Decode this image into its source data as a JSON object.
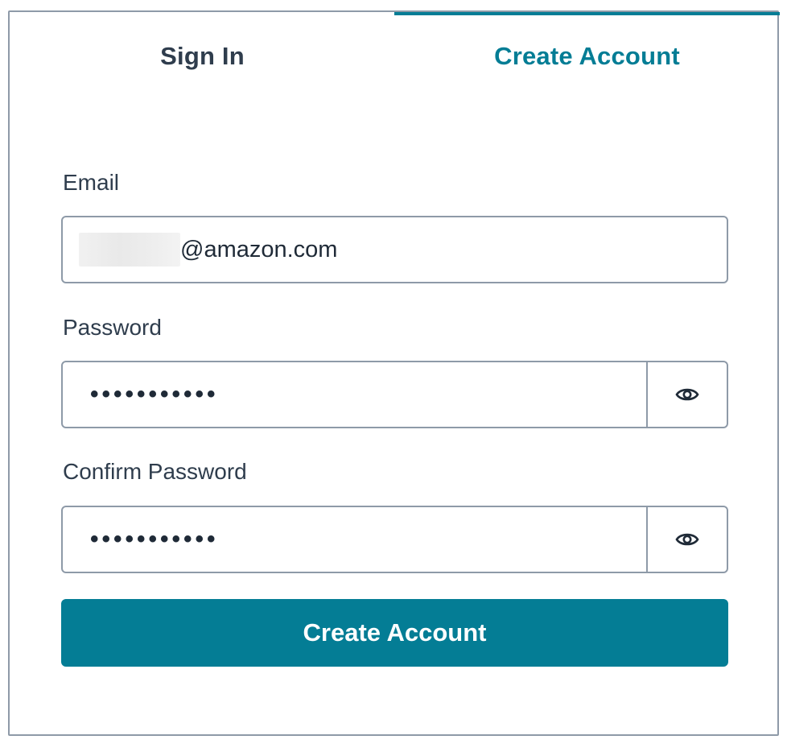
{
  "tabs": {
    "sign_in": "Sign In",
    "create_account": "Create Account",
    "active": "create_account"
  },
  "form": {
    "email": {
      "label": "Email",
      "value_visible": "@amazon.com"
    },
    "password": {
      "label": "Password",
      "value": "•••••••••••",
      "toggle_icon": "eye-icon"
    },
    "confirm_password": {
      "label": "Confirm Password",
      "value": "•••••••••••",
      "toggle_icon": "eye-icon"
    },
    "submit_label": "Create Account"
  },
  "colors": {
    "accent": "#047d95",
    "text": "#2f3d4d",
    "border": "#8e9aa8"
  }
}
